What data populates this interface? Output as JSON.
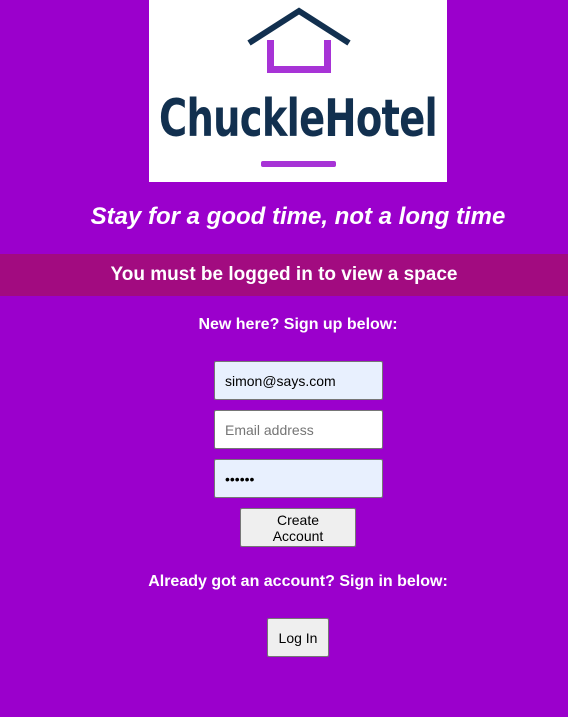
{
  "logo": {
    "brand": "ChuckleHotel",
    "icon": "house-icon",
    "colors": {
      "navy": "#12304f",
      "purple": "#a733d6"
    }
  },
  "tagline": "Stay for a good time, not a long time",
  "banner": "You must be logged in to view a space",
  "signup": {
    "heading": "New here? Sign up below:",
    "username_value": "simon@says.com",
    "email_placeholder": "Email address",
    "password_value": "secret",
    "submit_label": "Create Account"
  },
  "login": {
    "heading": "Already got an account? Sign in below:",
    "button_label": "Log In"
  },
  "colors": {
    "page_background": "#9b00cc",
    "banner_background": "#a20b80",
    "text": "#ffffff"
  }
}
